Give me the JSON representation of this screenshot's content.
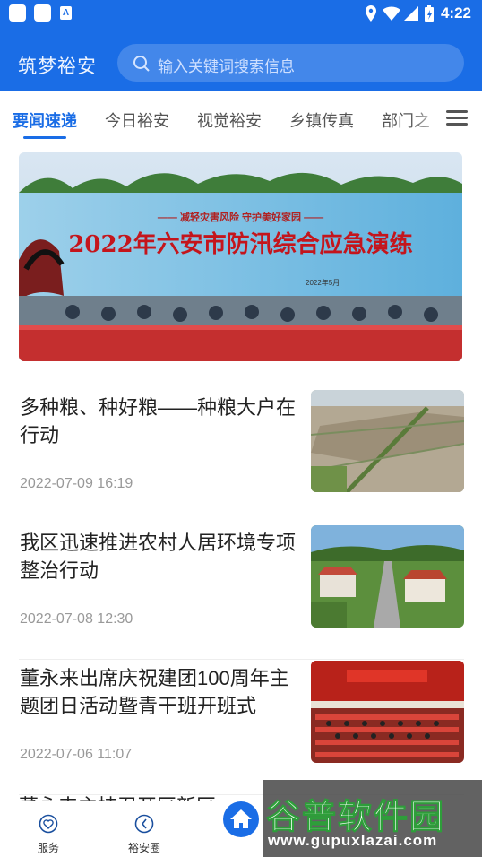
{
  "status_bar": {
    "time": "4:22",
    "a_label": "A"
  },
  "header": {
    "logo": "筑梦裕安",
    "search_placeholder": "输入关键词搜索信息"
  },
  "tabs": [
    {
      "label": "要闻速递",
      "active": true
    },
    {
      "label": "今日裕安",
      "active": false
    },
    {
      "label": "视觉裕安",
      "active": false
    },
    {
      "label": "乡镇传真",
      "active": false
    },
    {
      "label": "部门之",
      "active": false
    }
  ],
  "banner": {
    "slogan": "—— 减轻灾害风险  守护美好家园 ——",
    "title": "2022年六安市防汛综合应急演练",
    "footer": "2022年5月"
  },
  "news": [
    {
      "title": "多种粮、种好粮——种粮大户在行动",
      "date": "2022-07-09 16:19"
    },
    {
      "title": "我区迅速推进农村人居环境专项整治行动",
      "date": "2022-07-08 12:30"
    },
    {
      "title": "董永来出席庆祝建团100周年主题团日活动暨青干班开班式",
      "date": "2022-07-06 11:07"
    }
  ],
  "partial_title": "董永来主持召开区新区",
  "bottom_nav": [
    {
      "label": "服务",
      "icon": "heart-shield-icon"
    },
    {
      "label": "裕安圈",
      "icon": "compass-icon"
    },
    {
      "label": "",
      "icon": "home-icon"
    }
  ],
  "watermark": {
    "big": "谷普软件园",
    "small": "www.gupuxlazai.com"
  },
  "colors": {
    "brand": "#1a6de6"
  }
}
